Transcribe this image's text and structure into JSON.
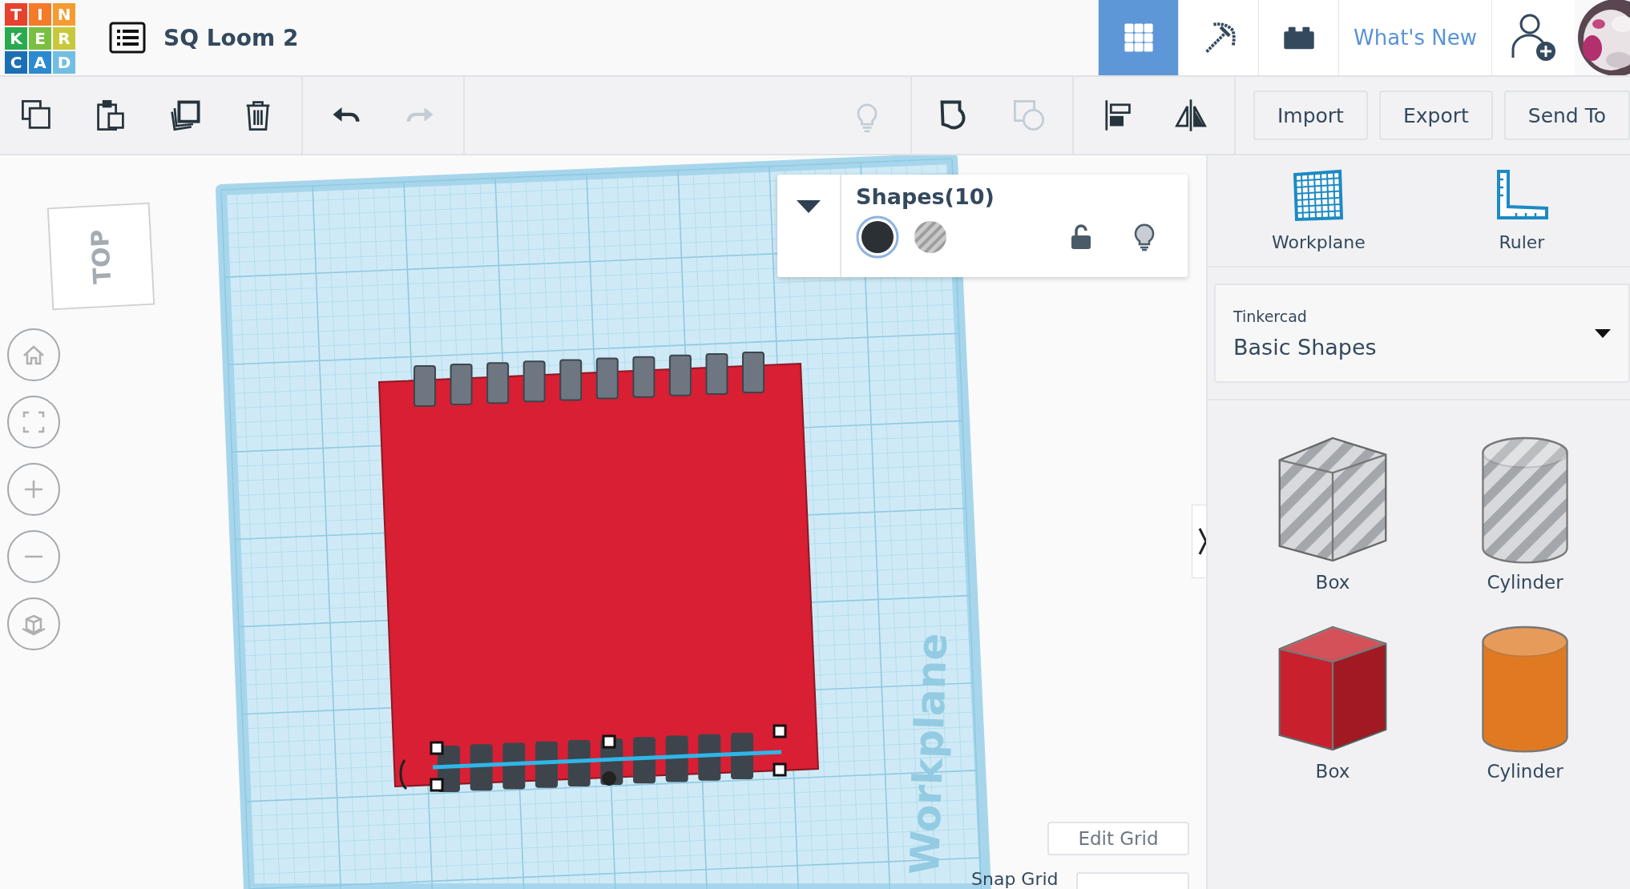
{
  "header": {
    "logo_letters": [
      "T",
      "I",
      "N",
      "K",
      "E",
      "R",
      "C",
      "A",
      "D"
    ],
    "project_title": "SQ Loom 2",
    "view_buttons": [
      {
        "kind": "grid",
        "selected": true
      },
      {
        "kind": "pickaxe",
        "selected": false
      },
      {
        "kind": "bricks",
        "selected": false
      }
    ],
    "whats_new": "What's New"
  },
  "toolbar": {
    "left_groups": [
      [
        {
          "kind": "copy",
          "disabled": false
        },
        {
          "kind": "paste",
          "disabled": false
        },
        {
          "kind": "duplicate",
          "disabled": false
        },
        {
          "kind": "delete",
          "disabled": false
        }
      ],
      [
        {
          "kind": "undo",
          "disabled": false
        },
        {
          "kind": "redo",
          "disabled": true
        }
      ]
    ],
    "right_groups": [
      [
        {
          "kind": "hide",
          "disabled": true
        }
      ],
      [
        {
          "kind": "group",
          "disabled": false
        },
        {
          "kind": "ungroup",
          "disabled": true
        }
      ],
      [
        {
          "kind": "align",
          "disabled": false
        },
        {
          "kind": "mirror",
          "disabled": false
        }
      ]
    ],
    "actions": [
      "Import",
      "Export",
      "Send To"
    ]
  },
  "view_cube": {
    "label": "TOP"
  },
  "inspector": {
    "title": "Shapes(10)",
    "fills": [
      {
        "kind": "solid",
        "selected": true
      },
      {
        "kind": "hole",
        "selected": false
      }
    ]
  },
  "workplane": {
    "label": "Workplane"
  },
  "edit_grid": "Edit Grid",
  "snap_grid": {
    "label": "Snap Grid"
  },
  "panel": {
    "tools": [
      {
        "kind": "workplane",
        "label": "Workplane"
      },
      {
        "kind": "ruler",
        "label": "Ruler"
      }
    ],
    "library": {
      "source": "Tinkercad",
      "name": "Basic Shapes"
    },
    "shapes": [
      {
        "kind": "box",
        "label": "Box",
        "hole": true
      },
      {
        "kind": "cylinder",
        "label": "Cylinder",
        "hole": true
      },
      {
        "kind": "box",
        "label": "Box",
        "hole": false,
        "color": "#c8202c"
      },
      {
        "kind": "cylinder",
        "label": "Cylinder",
        "hole": false,
        "color": "#e07a22"
      }
    ]
  }
}
